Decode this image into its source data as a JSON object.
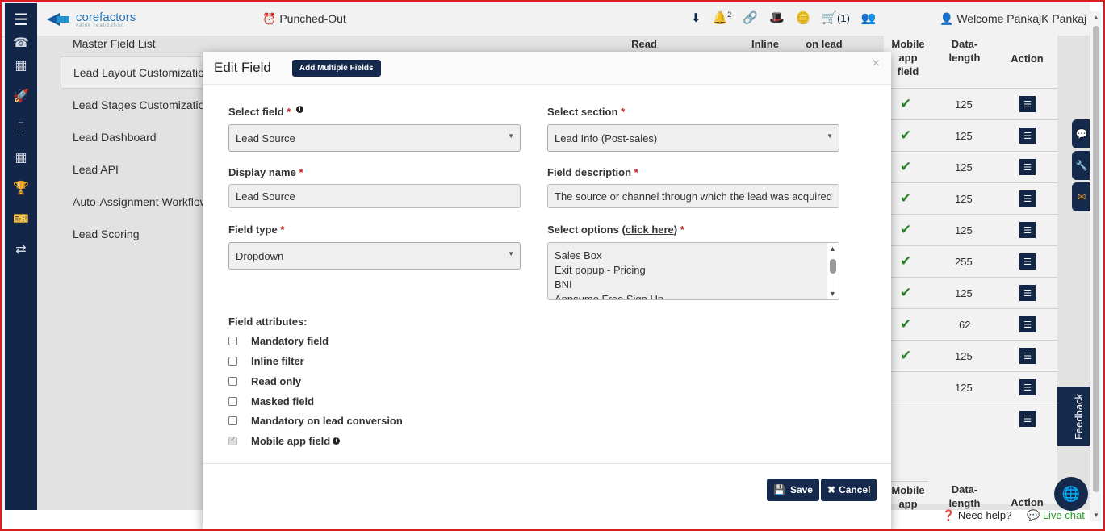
{
  "header": {
    "logo_text": "corefactors",
    "logo_sub": "value realization",
    "punch_status": "Punched-Out",
    "notifications_count": "2",
    "cart_count": "(1)",
    "welcome": "Welcome PankajK Pankaj"
  },
  "menu": {
    "items": [
      {
        "label": "Master Field List"
      },
      {
        "label": "Lead Layout Customization"
      },
      {
        "label": "Lead Stages Customization"
      },
      {
        "label": "Lead Dashboard"
      },
      {
        "label": "Lead API"
      },
      {
        "label": "Auto-Assignment Workflow"
      },
      {
        "label": "Lead Scoring"
      }
    ]
  },
  "bg_table": {
    "headers": {
      "read": "Read",
      "inline": "Inline",
      "on_lead": "on lead",
      "mobile": "Mobile app field",
      "length": "Data-length",
      "action": "Action"
    },
    "footer_headers": {
      "mobile": "Mobile app",
      "length": "Data-length",
      "action": "Action"
    },
    "lengths": [
      "125",
      "125",
      "125",
      "125",
      "125",
      "255",
      "125",
      "62",
      "125",
      "125",
      ""
    ]
  },
  "modal": {
    "title": "Edit Field",
    "add_multiple_label": "Add Multiple Fields",
    "select_field_label": "Select field",
    "select_field_value": "Lead Source",
    "select_section_label": "Select section",
    "select_section_value": "Lead Info (Post-sales)",
    "display_name_label": "Display name",
    "display_name_value": "Lead Source",
    "field_description_label": "Field description",
    "field_description_value": "The source or channel through which the lead was acquired",
    "field_type_label": "Field type",
    "field_type_value": "Dropdown",
    "select_options_label": "Select options (",
    "select_options_link": "click here",
    "select_options_close": ")",
    "options": [
      "Sales Box",
      "Exit popup - Pricing",
      "BNI",
      "Appsumo Free Sign Up"
    ],
    "attributes_label": "Field attributes:",
    "attributes": [
      {
        "label": "Mandatory field",
        "checked": false
      },
      {
        "label": "Inline filter",
        "checked": false
      },
      {
        "label": "Read only",
        "checked": false
      },
      {
        "label": "Masked field",
        "checked": false
      },
      {
        "label": "Mandatory on lead conversion",
        "checked": false
      },
      {
        "label": "Mobile app field",
        "checked": true
      }
    ],
    "save_label": "Save",
    "cancel_label": "Cancel"
  },
  "footer": {
    "need_help": "Need help?",
    "live_chat": "Live chat",
    "feedback": "Feedback"
  }
}
